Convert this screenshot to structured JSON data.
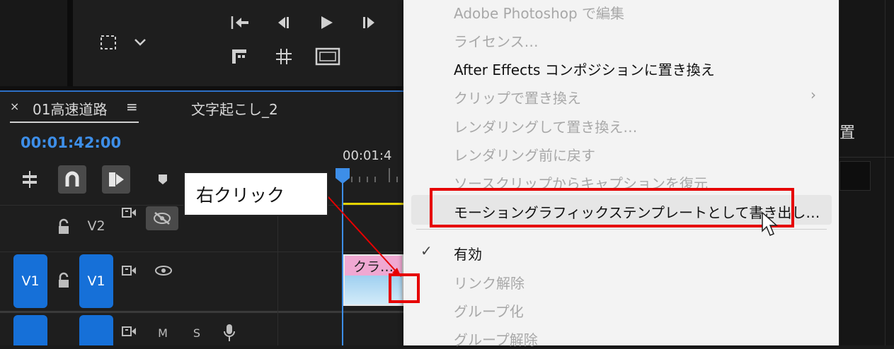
{
  "timeline": {
    "tabs": [
      {
        "close": "×",
        "label": "01高速道路",
        "menu": "≡"
      },
      {
        "label": "文字起こし_2"
      }
    ],
    "timecode": "00:01:42:00",
    "ruler_time": "00:01:4",
    "tracks": {
      "v2": {
        "label": "V2"
      },
      "v1": {
        "source": "V1",
        "target": "V1"
      },
      "a1": {
        "m": "M",
        "s": "S"
      }
    },
    "clip": {
      "label": "クラ…"
    }
  },
  "context_menu": {
    "items": [
      {
        "label": "Adobe Photoshop で編集",
        "enabled": false
      },
      {
        "label": "ライセンス…",
        "enabled": false
      },
      {
        "label": "After Effects コンポジションに置き換え",
        "enabled": true
      },
      {
        "label": "クリップで置き換え",
        "enabled": false,
        "submenu": true
      },
      {
        "label": "レンダリングして置き換え…",
        "enabled": false
      },
      {
        "label": "レンダリング前に戻す",
        "enabled": false
      },
      {
        "label": "ソースクリップからキャプションを復元",
        "enabled": false
      },
      {
        "label": "モーショングラフィックステンプレートとして書き出し…",
        "enabled": true,
        "hovered": true
      },
      {
        "label": "有効",
        "enabled": true,
        "checked": true
      },
      {
        "label": "リンク解除",
        "enabled": false
      },
      {
        "label": "グループ化",
        "enabled": false
      },
      {
        "label": "グループ解除",
        "enabled": false
      }
    ],
    "submenu_arrow": "›",
    "check_mark": "✓"
  },
  "annotation": {
    "callout_text": "右クリック",
    "highlight_color": "#e60000"
  },
  "right_panel": {
    "partial_text": "置"
  },
  "colors": {
    "accent_blue": "#1670d8",
    "timecode_blue": "#3d8ee8",
    "clip_pink": "#f0a8d2"
  }
}
